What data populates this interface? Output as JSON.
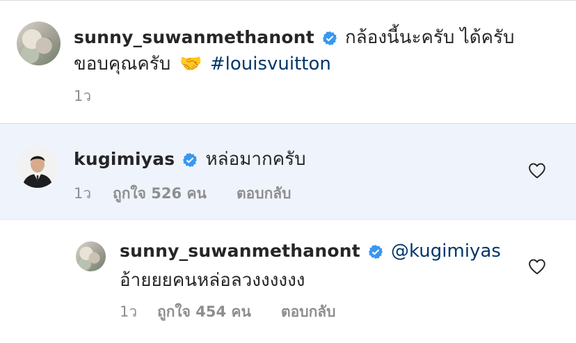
{
  "caption": {
    "username": "sunny_suwanmethanont",
    "text_line1": "กล้องนี้นะครับ ได้ครับ",
    "text_line2": "ขอบคุณครับ",
    "emoji": "🤝",
    "hashtag": "#louisvuitton",
    "time": "1ว"
  },
  "comments": [
    {
      "username": "kugimiyas",
      "text": "หล่อมากครับ",
      "time": "1ว",
      "likes": "ถูกใจ 526 คน",
      "reply_label": "ตอบกลับ"
    }
  ],
  "replies": [
    {
      "username": "sunny_suwanmethanont",
      "mention": "@kugimiyas",
      "text": "อ้ายยยคนหล่อลวงงงงงง",
      "time": "1ว",
      "likes": "ถูกใจ 454 คน",
      "reply_label": "ตอบกลับ"
    }
  ],
  "colors": {
    "verified": "#3897f0",
    "link": "#00376b",
    "highlight_bg": "#eff4fc",
    "meta": "#8e8e8e"
  },
  "icons": {
    "verified": "verified-badge-icon",
    "like": "heart-outline-icon"
  }
}
